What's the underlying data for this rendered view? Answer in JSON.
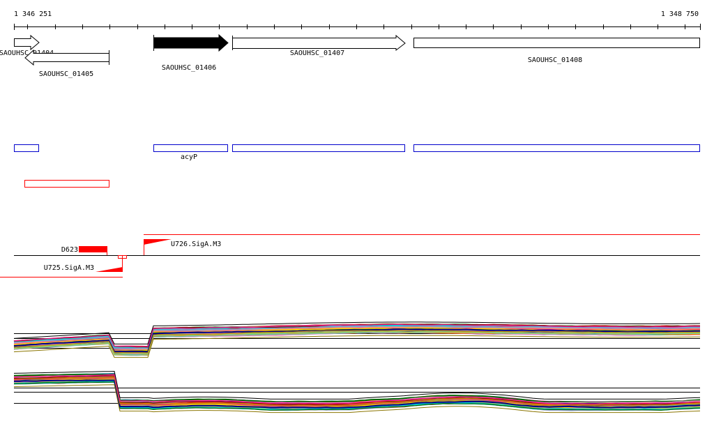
{
  "ruler": {
    "start_label": "1 346 251",
    "end_label": "1 348 750"
  },
  "genes": [
    {
      "id": "SAOUHSC_01404",
      "strand": "+"
    },
    {
      "id": "SAOUHSC_01405",
      "strand": "-"
    },
    {
      "id": "SAOUHSC_01406",
      "strand": "+",
      "selected": true
    },
    {
      "id": "SAOUHSC_01407",
      "strand": "+"
    },
    {
      "id": "SAOUHSC_01408",
      "strand": "+"
    }
  ],
  "annotations": {
    "acyp_label": "acyP"
  },
  "features": {
    "d623": "D623",
    "u725": "U725.SigA.M3",
    "u726": "U726.SigA.M3"
  },
  "colors": {
    "feature_red": "#ff0000",
    "cds_blue": "#0000cc",
    "line_black": "#000000"
  }
}
